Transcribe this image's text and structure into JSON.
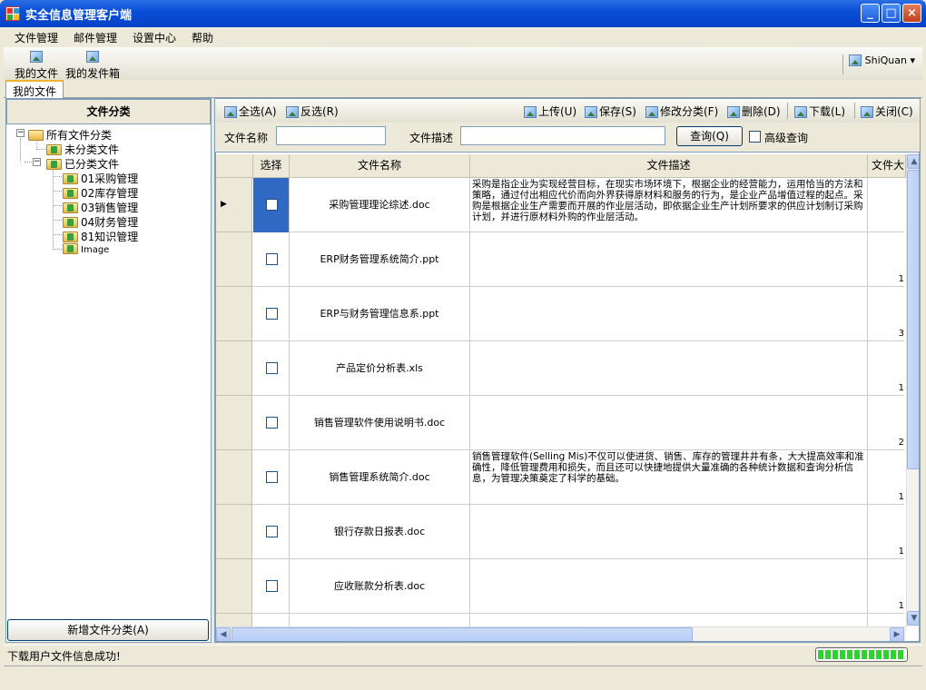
{
  "window": {
    "title": "实全信息管理客户端"
  },
  "menu": [
    "文件管理",
    "邮件管理",
    "设置中心",
    "帮助"
  ],
  "toolbar": {
    "items": [
      "我的文件",
      "我的发件箱"
    ],
    "user": "ShiQuan ▾"
  },
  "tabs": [
    "我的文件"
  ],
  "left": {
    "header": "文件分类",
    "tree": {
      "root": "所有文件分类",
      "unclassified": "未分类文件",
      "classified": "已分类文件",
      "children": [
        "01采购管理",
        "02库存管理",
        "03销售管理",
        "04财务管理",
        "81知识管理",
        "Image"
      ]
    },
    "add_button": "新增文件分类(A)"
  },
  "right": {
    "toolbar": {
      "left": [
        "全选(A)",
        "反选(R)"
      ],
      "right": [
        "上传(U)",
        "保存(S)",
        "修改分类(F)",
        "删除(D)",
        "下载(L)",
        "关闭(C)"
      ]
    },
    "search": {
      "name_label": "文件名称",
      "desc_label": "文件描述",
      "query_button": "查询(Q)",
      "advanced": "高级查询",
      "name_value": "",
      "desc_value": ""
    },
    "grid": {
      "columns": [
        "选择",
        "文件名称",
        "文件描述",
        "文件大"
      ],
      "rows": [
        {
          "name": "采购管理理论综述.doc",
          "desc": "采购是指企业为实现经营目标，在现实市场环境下，根据企业的经营能力，运用恰当的方法和策略，通过付出相应代价而向外界获得原材料和服务的行为，是企业产品增值过程的起点。采购是根据企业生产需要而开展的作业层活动，即依据企业生产计划所要求的供应计划制订采购计划，并进行原材料外购的作业层活动。",
          "size": "",
          "current": true
        },
        {
          "name": "ERP财务管理系统简介.ppt",
          "desc": "",
          "size": "1"
        },
        {
          "name": "ERP与财务管理信息系.ppt",
          "desc": "",
          "size": "3"
        },
        {
          "name": "产品定价分析表.xls",
          "desc": "",
          "size": "1"
        },
        {
          "name": "销售管理软件使用说明书.doc",
          "desc": "",
          "size": "2"
        },
        {
          "name": "销售管理系统简介.doc",
          "desc": "销售管理软件(Selling Mis)不仅可以使进货、销售、库存的管理井井有条，大大提高效率和准确性，降低管理费用和损失，而且还可以快捷地提供大量准确的各种统计数据和查询分析信息，为管理决策奠定了科学的基础。",
          "size": "1"
        },
        {
          "name": "银行存款日报表.doc",
          "desc": "",
          "size": "1"
        },
        {
          "name": "应收账款分析表.doc",
          "desc": "",
          "size": "1"
        }
      ]
    }
  },
  "status": {
    "text": "下载用户文件信息成功!",
    "progress": 1.0
  }
}
